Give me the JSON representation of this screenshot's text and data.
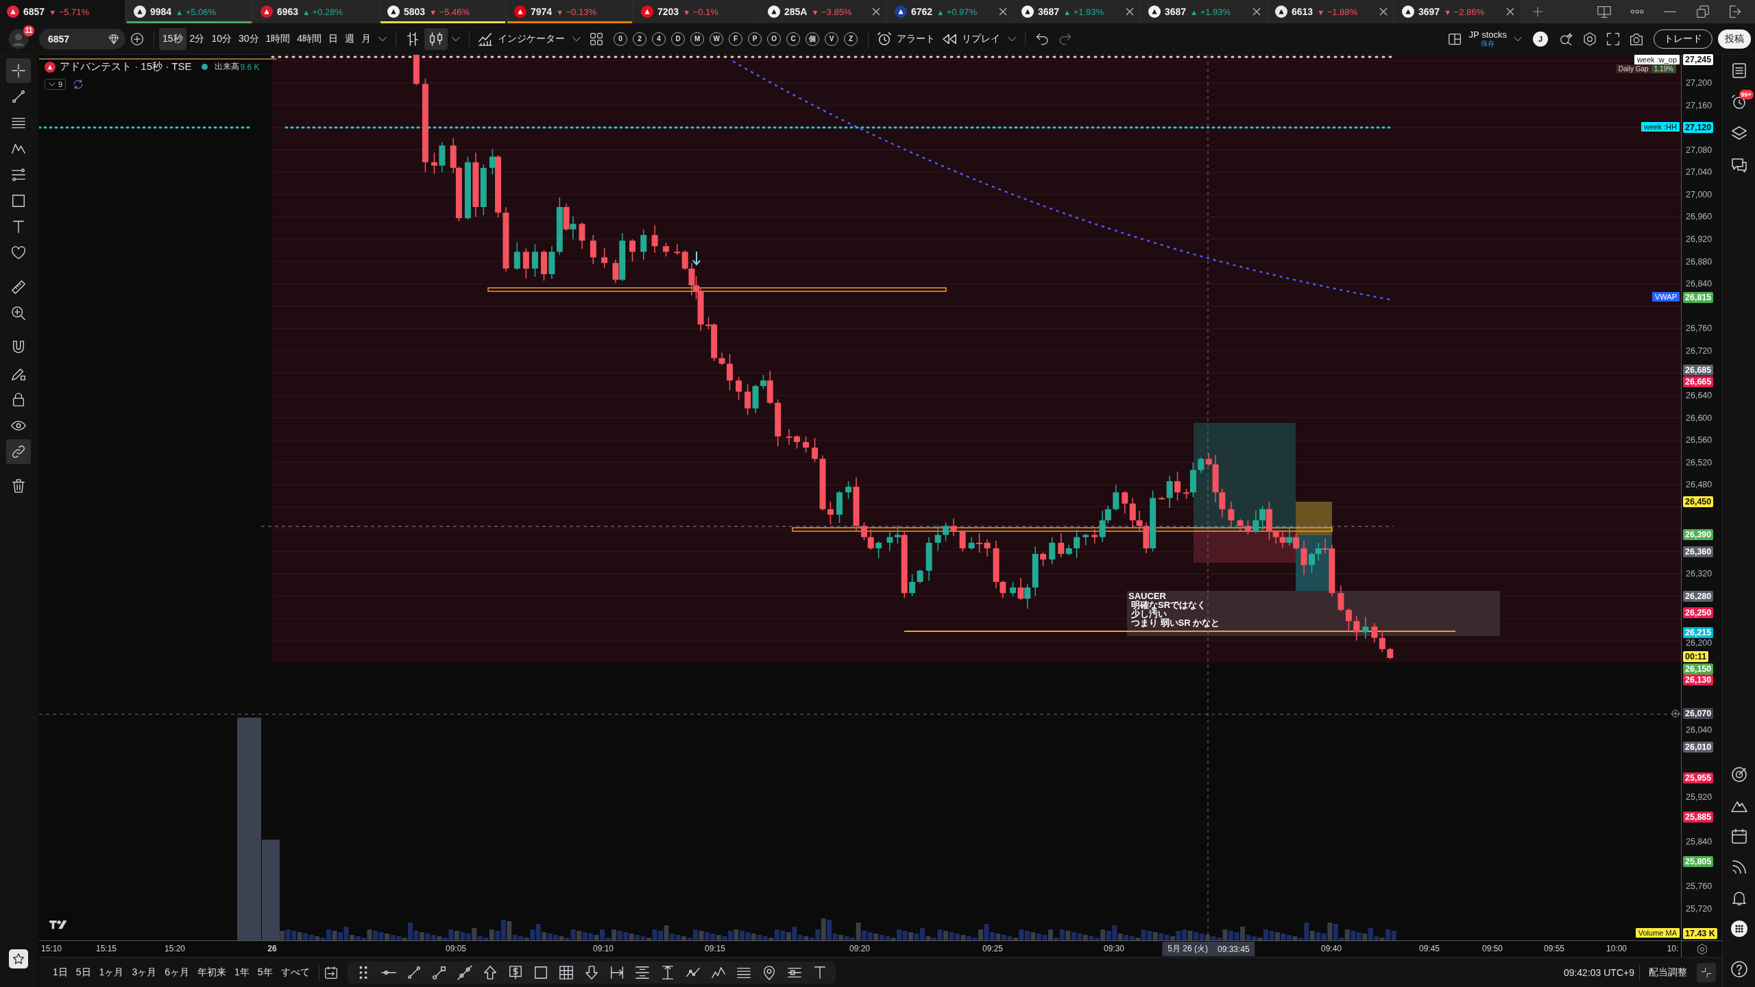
{
  "tabs": [
    {
      "symbol": "6857",
      "arrow": "▼",
      "change": "−5.71%",
      "rising": false,
      "selected": true,
      "closable": false,
      "logo": {
        "color": "#e0263c"
      }
    },
    {
      "symbol": "9984",
      "arrow": "▲",
      "change": "+5.06%",
      "rising": true,
      "selected": false,
      "closable": false,
      "logo": {
        "color": "#e6e6e6"
      },
      "link": {
        "color": "#4caf50"
      }
    },
    {
      "symbol": "6963",
      "arrow": "▲",
      "change": "+0.28%",
      "rising": true,
      "selected": false,
      "closable": false,
      "logo": {
        "color": "#d7192d"
      }
    },
    {
      "symbol": "5803",
      "arrow": "▼",
      "change": "−5.46%",
      "rising": false,
      "selected": false,
      "closable": false,
      "logo": {
        "color": "#f2f2f2"
      },
      "link": {
        "color": "#fdd835"
      }
    },
    {
      "symbol": "7974",
      "arrow": "▼",
      "change": "−0.13%",
      "rising": false,
      "selected": false,
      "closable": false,
      "logo": {
        "color": "#e60012"
      },
      "link": {
        "color": "#f57c00"
      }
    },
    {
      "symbol": "7203",
      "arrow": "▼",
      "change": "−0.1%",
      "rising": false,
      "selected": false,
      "closable": false,
      "logo": {
        "color": "#eb0a1e"
      }
    },
    {
      "symbol": "285A",
      "arrow": "▼",
      "change": "−3.85%",
      "rising": false,
      "selected": false,
      "closable": true,
      "logo": {
        "color": "#f2f2f2"
      }
    },
    {
      "symbol": "6762",
      "arrow": "▲",
      "change": "+0.97%",
      "rising": true,
      "selected": false,
      "closable": true,
      "logo": {
        "color": "#1a3f95"
      }
    },
    {
      "symbol": "3687",
      "arrow": "▲",
      "change": "+1.93%",
      "rising": true,
      "selected": false,
      "closable": true,
      "logo": {
        "color": "#f2f2f2"
      }
    },
    {
      "symbol": "3687",
      "arrow": "▲",
      "change": "+1.93%",
      "rising": true,
      "selected": false,
      "closable": true,
      "logo": {
        "color": "#f2f2f2"
      }
    },
    {
      "symbol": "6613",
      "arrow": "▼",
      "change": "−1.88%",
      "rising": false,
      "selected": false,
      "closable": true,
      "logo": {
        "color": "#e8e8e8"
      }
    },
    {
      "symbol": "3697",
      "arrow": "▼",
      "change": "−2.86%",
      "rising": false,
      "selected": false,
      "closable": true,
      "logo": {
        "color": "#f2f2f2"
      }
    }
  ],
  "toolbar": {
    "notifications": "11",
    "symbol": "6857",
    "intervals": [
      {
        "label": "15秒",
        "selected": true
      },
      {
        "label": "2分",
        "selected": false
      },
      {
        "label": "10分",
        "selected": false
      },
      {
        "label": "30分",
        "selected": false
      },
      {
        "label": "1時間",
        "selected": false
      },
      {
        "label": "4時間",
        "selected": false
      },
      {
        "label": "日",
        "selected": false
      },
      {
        "label": "週",
        "selected": false
      },
      {
        "label": "月",
        "selected": false
      }
    ],
    "chart_styles": [
      {
        "kind": "bars",
        "selected": false
      },
      {
        "kind": "candles",
        "selected": true
      }
    ],
    "indicators": "インジケーター",
    "quick_buttons": [
      "0",
      "2",
      "4",
      "D",
      "M",
      "W",
      "F",
      "P",
      "O",
      "C",
      "個",
      "V",
      "Z"
    ],
    "alert": "アラート",
    "replay": "リプレイ",
    "layout_name": "JP stocks",
    "layout_status": "保存",
    "user_initial": "J",
    "trade": "トレード",
    "publish": "投稿"
  },
  "left_toolbar": [
    {
      "tools": [
        {
          "kind": "crosshair",
          "selected": true
        },
        {
          "kind": "trend-line",
          "selected": false
        },
        {
          "kind": "parallel-lines",
          "selected": false
        },
        {
          "kind": "zigzag",
          "selected": false
        },
        {
          "kind": "forecast-lines",
          "selected": false
        },
        {
          "kind": "rectangle",
          "selected": false
        },
        {
          "kind": "text",
          "selected": false
        },
        {
          "kind": "heart",
          "selected": false
        }
      ]
    },
    {
      "tools": [
        {
          "kind": "ruler",
          "selected": false
        },
        {
          "kind": "zoom-in",
          "selected": false
        }
      ]
    },
    {
      "tools": [
        {
          "kind": "magnet",
          "selected": false
        },
        {
          "kind": "pencil-lock",
          "selected": false
        },
        {
          "kind": "lock",
          "selected": false
        },
        {
          "kind": "eye",
          "selected": false
        },
        {
          "kind": "link",
          "selected": true
        }
      ]
    },
    {
      "tools": [
        {
          "kind": "trash",
          "selected": false
        }
      ]
    }
  ],
  "chart": {
    "title": "アドバンテスト · 15秒 · TSE",
    "volume_label": "出来高",
    "volume_value": "9.6 K",
    "indicator_count": "9",
    "daily_gap": {
      "label": "Daily Gap",
      "value": "1.19%"
    },
    "level_labels": [
      {
        "text": "week :w_op",
        "color": "#ffffff"
      },
      {
        "text": "week :HH",
        "color": "#00e5ff"
      },
      {
        "text": "VWAP",
        "color": "#2962ff"
      },
      {
        "text": "Volume MA",
        "color": "#ffeb3b"
      }
    ],
    "note": {
      "title": "SAUCER",
      "lines": [
        "明確なSRではなく",
        "少し汚い",
        "つまり 弱いSR かなと"
      ]
    }
  },
  "price_axis": {
    "ticks": [
      "27,200",
      "27,160",
      "27,080",
      "27,040",
      "27,000",
      "26,960",
      "26,920",
      "26,880",
      "26,840",
      "26,760",
      "26,720",
      "26,640",
      "26,600",
      "26,560",
      "26,520",
      "26,480",
      "26,320",
      "26,200",
      "26,040",
      "25,920",
      "25,840",
      "25,760",
      "25,720"
    ],
    "tags": [
      {
        "text": "27,245",
        "color": "#ffffff"
      },
      {
        "text": "27,120",
        "color": "#00e5ff"
      },
      {
        "text": "26,815",
        "color": "#4caf50"
      },
      {
        "text": "26,685",
        "color": "#5d606b"
      },
      {
        "text": "26,665",
        "color": "#e91e4f"
      },
      {
        "text": "26,450",
        "color": "#ffeb3b"
      },
      {
        "text": "26,390",
        "color": "#4caf50"
      },
      {
        "text": "26,360",
        "color": "#5d606b"
      },
      {
        "text": "26,280",
        "color": "#5d606b"
      },
      {
        "text": "26,250",
        "color": "#e91e4f"
      },
      {
        "text": "26,215",
        "color": "#00bcd4"
      },
      {
        "text": "00:11",
        "color": "#ffeb3b"
      },
      {
        "text": "26,150",
        "color": "#4caf50"
      },
      {
        "text": "26,130",
        "color": "#e91e4f"
      },
      {
        "text": "26,070",
        "color": "#434651"
      },
      {
        "text": "26,010",
        "color": "#5d606b"
      },
      {
        "text": "25,955",
        "color": "#e91e4f"
      },
      {
        "text": "25,885",
        "color": "#e91e4f"
      },
      {
        "text": "25,805",
        "color": "#4caf50"
      },
      {
        "text": "17.43 K",
        "color": "#ffeb3b"
      }
    ]
  },
  "time_axis": {
    "labels": [
      {
        "text": "15:10",
        "kind": "time"
      },
      {
        "text": "15:15",
        "kind": "time"
      },
      {
        "text": "15:20",
        "kind": "time"
      },
      {
        "text": "26",
        "kind": "day"
      },
      {
        "text": "09:05",
        "kind": "time"
      },
      {
        "text": "09:10",
        "kind": "time"
      },
      {
        "text": "09:15",
        "kind": "time"
      },
      {
        "text": "09:20",
        "kind": "time"
      },
      {
        "text": "09:25",
        "kind": "time"
      },
      {
        "text": "09:30",
        "kind": "time"
      },
      {
        "text": "09:40",
        "kind": "time"
      },
      {
        "text": "09:45",
        "kind": "time"
      },
      {
        "text": "09:50",
        "kind": "time"
      },
      {
        "text": "09:55",
        "kind": "time"
      },
      {
        "text": "10:00",
        "kind": "time"
      },
      {
        "text": "10:",
        "kind": "time"
      }
    ],
    "cursor": {
      "date": "5月 26 (火)",
      "time": "09:33:45"
    }
  },
  "bottom_bar": {
    "ranges": [
      "1日",
      "5日",
      "1ヶ月",
      "3ヶ月",
      "6ヶ月",
      "年初来",
      "1年",
      "5年",
      "すべて"
    ],
    "clock": "09:42:03 UTC+9",
    "adjustment": "配当調整"
  },
  "right_sidebar": {
    "alerts_badge": "99+"
  }
}
